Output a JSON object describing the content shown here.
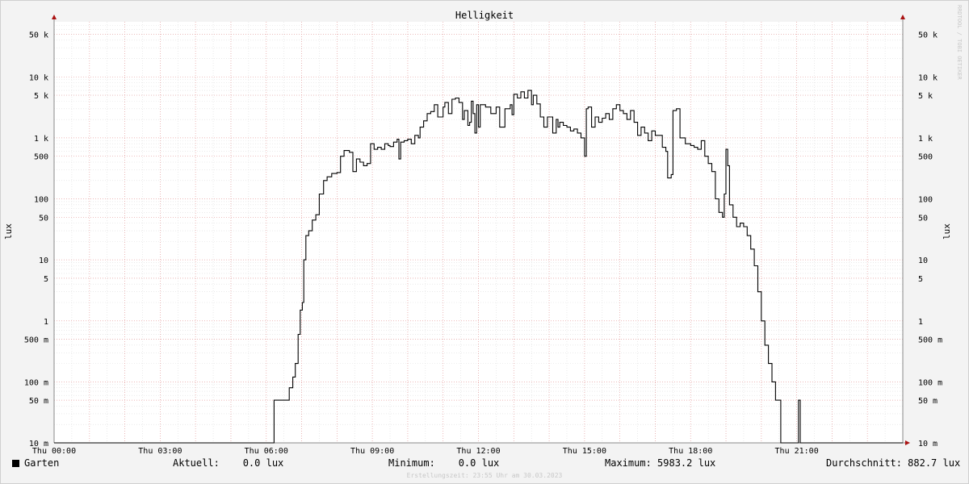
{
  "chart_data": {
    "type": "line",
    "title": "Helligkeit",
    "ylabel": "lux",
    "yscale": "log",
    "ylim": [
      0.01,
      80000
    ],
    "xlim_hours": [
      0,
      24
    ],
    "yticks": [
      {
        "v": 50000,
        "label": "50 k"
      },
      {
        "v": 10000,
        "label": "10 k"
      },
      {
        "v": 5000,
        "label": "5 k"
      },
      {
        "v": 1000,
        "label": "1 k"
      },
      {
        "v": 500,
        "label": "500"
      },
      {
        "v": 100,
        "label": "100"
      },
      {
        "v": 50,
        "label": "50"
      },
      {
        "v": 10,
        "label": "10"
      },
      {
        "v": 5,
        "label": "5"
      },
      {
        "v": 1,
        "label": "1"
      },
      {
        "v": 0.5,
        "label": "500 m"
      },
      {
        "v": 0.1,
        "label": "100 m"
      },
      {
        "v": 0.05,
        "label": "50 m"
      },
      {
        "v": 0.01,
        "label": "10 m"
      }
    ],
    "xticks": [
      {
        "h": 0,
        "label": "Thu 00:00"
      },
      {
        "h": 3,
        "label": "Thu 03:00"
      },
      {
        "h": 6,
        "label": "Thu 06:00"
      },
      {
        "h": 9,
        "label": "Thu 09:00"
      },
      {
        "h": 12,
        "label": "Thu 12:00"
      },
      {
        "h": 15,
        "label": "Thu 15:00"
      },
      {
        "h": 18,
        "label": "Thu 18:00"
      },
      {
        "h": 21,
        "label": "Thu 21:00"
      }
    ],
    "series": [
      {
        "name": "Garten",
        "color": "#000000",
        "points": [
          [
            0,
            0.01
          ],
          [
            6.2,
            0.01
          ],
          [
            6.22,
            0.05
          ],
          [
            6.6,
            0.05
          ],
          [
            6.65,
            0.08
          ],
          [
            6.7,
            0.08
          ],
          [
            6.75,
            0.12
          ],
          [
            6.82,
            0.2
          ],
          [
            6.9,
            0.6
          ],
          [
            6.96,
            1.5
          ],
          [
            7.02,
            2
          ],
          [
            7.06,
            10
          ],
          [
            7.12,
            25
          ],
          [
            7.2,
            30
          ],
          [
            7.3,
            45
          ],
          [
            7.4,
            55
          ],
          [
            7.5,
            120
          ],
          [
            7.62,
            200
          ],
          [
            7.72,
            230
          ],
          [
            7.85,
            260
          ],
          [
            8.0,
            270
          ],
          [
            8.1,
            500
          ],
          [
            8.2,
            620
          ],
          [
            8.35,
            580
          ],
          [
            8.45,
            280
          ],
          [
            8.55,
            450
          ],
          [
            8.65,
            400
          ],
          [
            8.75,
            350
          ],
          [
            8.85,
            380
          ],
          [
            8.95,
            800
          ],
          [
            9.05,
            650
          ],
          [
            9.15,
            700
          ],
          [
            9.25,
            650
          ],
          [
            9.35,
            800
          ],
          [
            9.45,
            750
          ],
          [
            9.5,
            720
          ],
          [
            9.6,
            850
          ],
          [
            9.7,
            950
          ],
          [
            9.75,
            450
          ],
          [
            9.8,
            850
          ],
          [
            9.9,
            900
          ],
          [
            10.0,
            950
          ],
          [
            10.1,
            800
          ],
          [
            10.2,
            1100
          ],
          [
            10.3,
            1000
          ],
          [
            10.35,
            1500
          ],
          [
            10.45,
            1900
          ],
          [
            10.55,
            2500
          ],
          [
            10.65,
            2700
          ],
          [
            10.75,
            3500
          ],
          [
            10.85,
            2200
          ],
          [
            11.0,
            3200
          ],
          [
            11.05,
            3800
          ],
          [
            11.15,
            2500
          ],
          [
            11.25,
            4300
          ],
          [
            11.35,
            4500
          ],
          [
            11.45,
            3800
          ],
          [
            11.55,
            2000
          ],
          [
            11.6,
            2800
          ],
          [
            11.7,
            1600
          ],
          [
            11.75,
            1800
          ],
          [
            11.8,
            4000
          ],
          [
            11.85,
            2500
          ],
          [
            11.9,
            1200
          ],
          [
            11.95,
            3500
          ],
          [
            12.0,
            1500
          ],
          [
            12.05,
            3500
          ],
          [
            12.2,
            3200
          ],
          [
            12.35,
            2500
          ],
          [
            12.5,
            3200
          ],
          [
            12.6,
            1500
          ],
          [
            12.75,
            3000
          ],
          [
            12.9,
            3500
          ],
          [
            12.95,
            2400
          ],
          [
            13.0,
            5200
          ],
          [
            13.1,
            4500
          ],
          [
            13.2,
            5700
          ],
          [
            13.3,
            4500
          ],
          [
            13.4,
            6000
          ],
          [
            13.5,
            3500
          ],
          [
            13.55,
            5000
          ],
          [
            13.65,
            3600
          ],
          [
            13.75,
            2200
          ],
          [
            13.85,
            1500
          ],
          [
            13.95,
            2200
          ],
          [
            14.1,
            1200
          ],
          [
            14.2,
            2000
          ],
          [
            14.25,
            1500
          ],
          [
            14.3,
            1800
          ],
          [
            14.4,
            1600
          ],
          [
            14.5,
            1500
          ],
          [
            14.6,
            1300
          ],
          [
            14.7,
            1400
          ],
          [
            14.8,
            1200
          ],
          [
            14.9,
            1000
          ],
          [
            15.0,
            500
          ],
          [
            15.05,
            3000
          ],
          [
            15.1,
            3200
          ],
          [
            15.2,
            1500
          ],
          [
            15.3,
            2200
          ],
          [
            15.4,
            1800
          ],
          [
            15.5,
            2100
          ],
          [
            15.6,
            2500
          ],
          [
            15.7,
            2000
          ],
          [
            15.8,
            3000
          ],
          [
            15.9,
            3500
          ],
          [
            16.0,
            2800
          ],
          [
            16.1,
            2500
          ],
          [
            16.2,
            2000
          ],
          [
            16.3,
            2800
          ],
          [
            16.4,
            1800
          ],
          [
            16.5,
            1100
          ],
          [
            16.6,
            1500
          ],
          [
            16.7,
            1200
          ],
          [
            16.8,
            900
          ],
          [
            16.9,
            1300
          ],
          [
            17.0,
            1100
          ],
          [
            17.2,
            700
          ],
          [
            17.3,
            600
          ],
          [
            17.35,
            220
          ],
          [
            17.45,
            250
          ],
          [
            17.5,
            2800
          ],
          [
            17.6,
            3000
          ],
          [
            17.7,
            1000
          ],
          [
            17.85,
            800
          ],
          [
            18.0,
            750
          ],
          [
            18.1,
            700
          ],
          [
            18.2,
            650
          ],
          [
            18.3,
            900
          ],
          [
            18.4,
            500
          ],
          [
            18.5,
            380
          ],
          [
            18.6,
            280
          ],
          [
            18.7,
            100
          ],
          [
            18.8,
            60
          ],
          [
            18.9,
            50
          ],
          [
            18.95,
            120
          ],
          [
            19.0,
            650
          ],
          [
            19.05,
            350
          ],
          [
            19.1,
            80
          ],
          [
            19.2,
            50
          ],
          [
            19.3,
            35
          ],
          [
            19.4,
            40
          ],
          [
            19.5,
            35
          ],
          [
            19.6,
            25
          ],
          [
            19.7,
            15
          ],
          [
            19.8,
            8
          ],
          [
            19.9,
            3
          ],
          [
            20.0,
            1
          ],
          [
            20.1,
            0.4
          ],
          [
            20.2,
            0.2
          ],
          [
            20.3,
            0.1
          ],
          [
            20.4,
            0.05
          ],
          [
            20.5,
            0.05
          ],
          [
            20.55,
            0.01
          ],
          [
            21.0,
            0.01
          ],
          [
            21.05,
            0.05
          ],
          [
            21.1,
            0.01
          ],
          [
            24,
            0.01
          ]
        ]
      }
    ]
  },
  "legend": {
    "series_name": "Garten",
    "aktuell": "Aktuell:    0.0 lux",
    "minimum": "Minimum:    0.0 lux",
    "maximum": "Maximum: 5983.2 lux",
    "durchschnitt": "Durchschnitt: 882.7 lux"
  },
  "footer": "Erstellungszeit: 23:55 Uhr am 30.03.2023",
  "watermark": "RRDTOOL / TOBI OETIKER",
  "colors": {
    "grid_major": "#e8a0a0",
    "grid_minor": "#dddddd",
    "axis": "#888888",
    "arrow": "#aa1111",
    "line": "#000000"
  }
}
